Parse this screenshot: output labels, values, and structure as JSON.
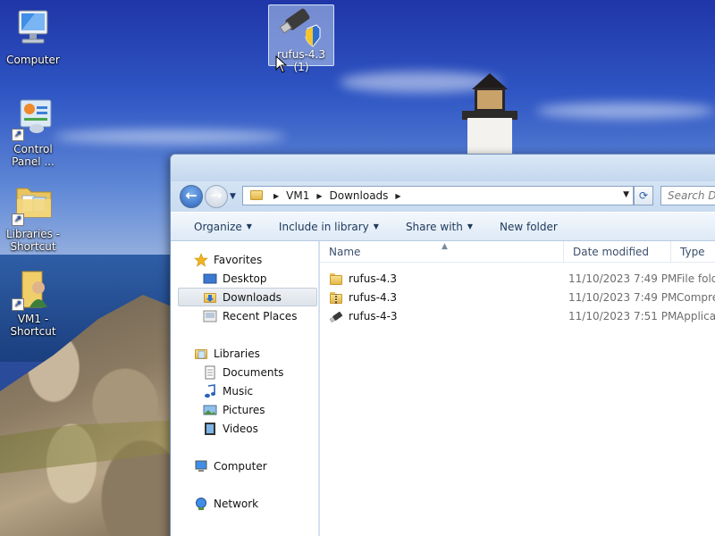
{
  "desktop": {
    "icons": [
      {
        "label": "Computer"
      },
      {
        "label": "Control Panel ..."
      },
      {
        "label": "Libraries - Shortcut"
      },
      {
        "label": "VM1 - Shortcut"
      }
    ],
    "dragged_item": {
      "label": "rufus-4.3 (1)"
    }
  },
  "explorer": {
    "breadcrumb": [
      "VM1",
      "Downloads"
    ],
    "search_placeholder": "Search Do",
    "toolbar": {
      "organize": "Organize",
      "include_in_library": "Include in library",
      "share_with": "Share with",
      "new_folder": "New folder"
    },
    "nav_pane": {
      "favorites": "Favorites",
      "favorites_items": [
        "Desktop",
        "Downloads",
        "Recent Places"
      ],
      "libraries": "Libraries",
      "libraries_items": [
        "Documents",
        "Music",
        "Pictures",
        "Videos"
      ],
      "computer": "Computer",
      "network": "Network",
      "selected": "Downloads"
    },
    "columns": {
      "name": "Name",
      "date_modified": "Date modified",
      "type": "Type"
    },
    "files": [
      {
        "name": "rufus-4.3",
        "date": "11/10/2023 7:49 PM",
        "type": "File fold",
        "icon": "folder-icon"
      },
      {
        "name": "rufus-4.3",
        "date": "11/10/2023 7:49 PM",
        "type": "Compre",
        "icon": "zip-folder-icon"
      },
      {
        "name": "rufus-4-3",
        "date": "11/10/2023 7:51 PM",
        "type": "Applicat",
        "icon": "usb-app-icon"
      }
    ]
  }
}
